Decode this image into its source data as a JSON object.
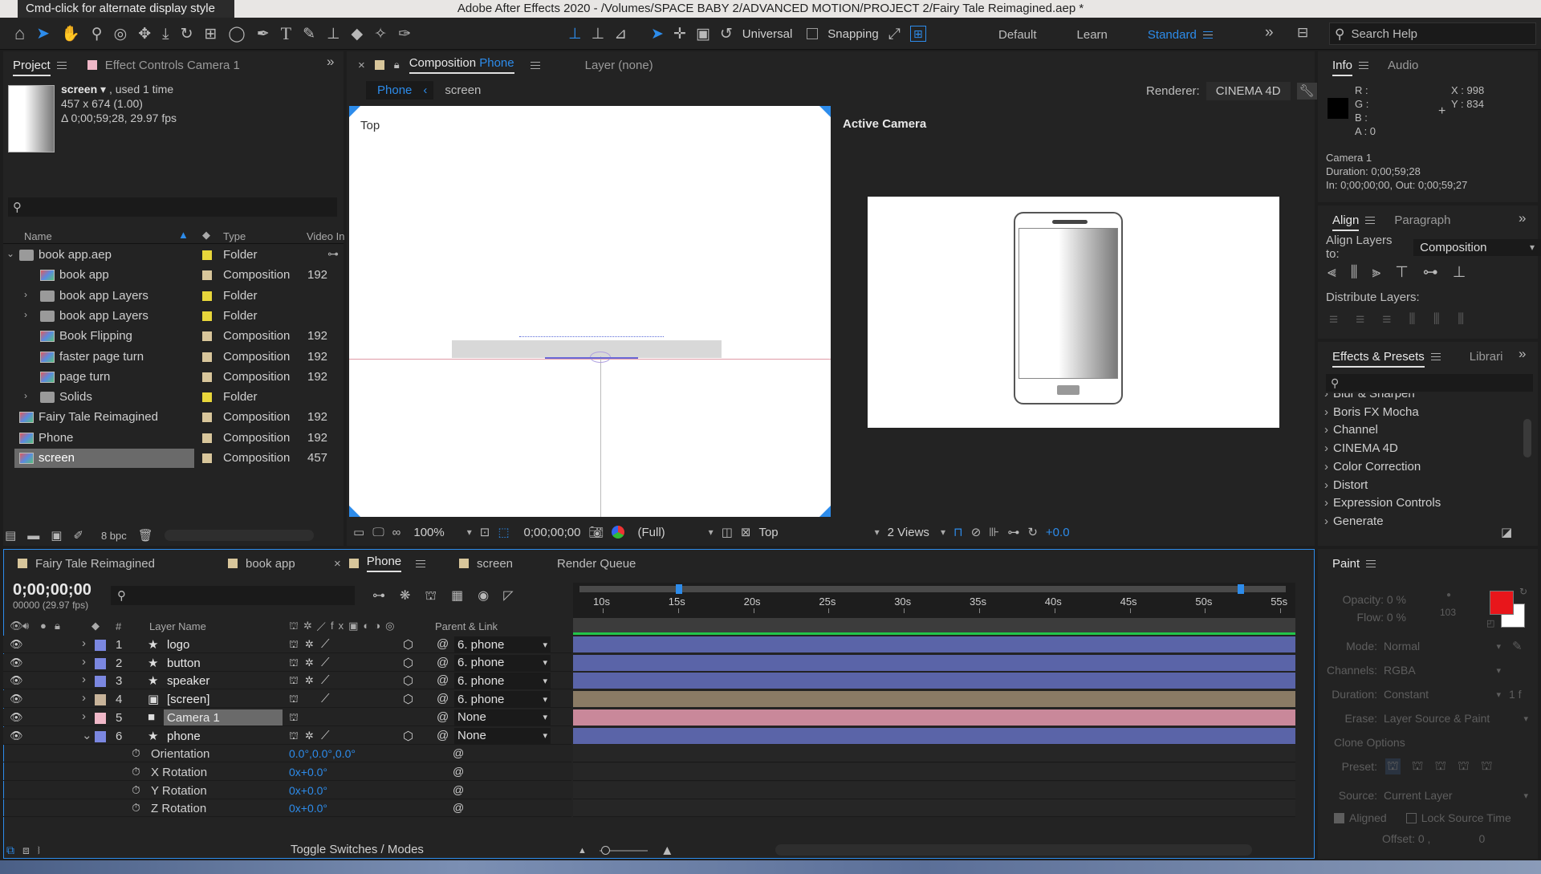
{
  "system": {
    "tooltip": "Cmd-click for alternate display style",
    "window_title": "Adobe After Effects 2020 - /Volumes/SPACE BABY 2/ADVANCED MOTION/PROJECT 2/Fairy Tale Reimagined.aep *"
  },
  "toolbar": {
    "axis_mode": "Universal",
    "snapping": "Snapping",
    "workspaces": [
      "Default",
      "Learn",
      "Standard"
    ],
    "search_placeholder": "Search Help"
  },
  "project_panel": {
    "tabs": [
      "Project",
      "Effect Controls Camera 1"
    ],
    "item_name": "screen",
    "item_used": ", used 1 time",
    "item_dims": "457 x 674 (1.00)",
    "item_duration": "Δ 0;00;59;28, 29.97 fps",
    "columns": [
      "Name",
      "Type",
      "Video In"
    ],
    "items": [
      {
        "name": "book app.aep",
        "type": "Folder",
        "vid": "",
        "color": "#e8d63b",
        "kind": "folder",
        "indent": 0,
        "twirl": "open"
      },
      {
        "name": "book app",
        "type": "Composition",
        "vid": "192",
        "color": "#d8c69b",
        "kind": "comp",
        "indent": 1,
        "twirl": ""
      },
      {
        "name": "book app Layers",
        "type": "Folder",
        "vid": "",
        "color": "#e8d63b",
        "kind": "folder",
        "indent": 1,
        "twirl": "closed"
      },
      {
        "name": "book app Layers",
        "type": "Folder",
        "vid": "",
        "color": "#e8d63b",
        "kind": "folder",
        "indent": 1,
        "twirl": "closed"
      },
      {
        "name": "Book Flipping",
        "type": "Composition",
        "vid": "192",
        "color": "#d8c69b",
        "kind": "comp",
        "indent": 1,
        "twirl": ""
      },
      {
        "name": "faster page turn",
        "type": "Composition",
        "vid": "192",
        "color": "#d8c69b",
        "kind": "comp",
        "indent": 1,
        "twirl": ""
      },
      {
        "name": "page turn",
        "type": "Composition",
        "vid": "192",
        "color": "#d8c69b",
        "kind": "comp",
        "indent": 1,
        "twirl": ""
      },
      {
        "name": "Solids",
        "type": "Folder",
        "vid": "",
        "color": "#e8d63b",
        "kind": "folder",
        "indent": 1,
        "twirl": "closed"
      },
      {
        "name": "Fairy Tale Reimagined",
        "type": "Composition",
        "vid": "192",
        "color": "#d8c69b",
        "kind": "comp",
        "indent": 0,
        "twirl": ""
      },
      {
        "name": "Phone",
        "type": "Composition",
        "vid": "192",
        "color": "#d8c69b",
        "kind": "comp",
        "indent": 0,
        "twirl": ""
      },
      {
        "name": "screen",
        "type": "Composition",
        "vid": "457",
        "color": "#d8c69b",
        "kind": "comp",
        "indent": 0,
        "twirl": "",
        "selected": true
      }
    ],
    "bpc": "8 bpc"
  },
  "composition_panel": {
    "tab_prefix": "Composition",
    "tab_name": "Phone",
    "layer_tab": "Layer (none)",
    "breadcrumbs": [
      "Phone",
      "screen"
    ],
    "renderer_label": "Renderer:",
    "renderer_value": "CINEMA 4D",
    "left_view_label": "Top",
    "right_view_label": "Active Camera",
    "zoom": "100%",
    "timecode": "0;00;00;00",
    "resolution": "(Full)",
    "view": "Top",
    "views_count": "2 Views",
    "exposure": "+0.0"
  },
  "info_panel": {
    "tabs": [
      "Info",
      "Audio"
    ],
    "rgba_labels": [
      "R :",
      "G :",
      "B :",
      "A :  0"
    ],
    "x": "X : 998",
    "y": "Y : 834",
    "layer_name": "Camera 1",
    "duration": "Duration: 0;00;59;28",
    "in_out": "In: 0;00;00;00, Out: 0;00;59;27"
  },
  "align_panel": {
    "tabs": [
      "Align",
      "Paragraph"
    ],
    "align_to_label": "Align Layers to:",
    "align_to_value": "Composition",
    "distribute_label": "Distribute Layers:"
  },
  "effects_panel": {
    "tabs": [
      "Effects & Presets",
      "Librari"
    ],
    "items": [
      "Blur & Sharpen",
      "Boris FX Mocha",
      "Channel",
      "CINEMA 4D",
      "Color Correction",
      "Distort",
      "Expression Controls",
      "Generate"
    ]
  },
  "timeline": {
    "tabs": [
      {
        "label": "Fairy Tale Reimagined",
        "color": "#d8c69b"
      },
      {
        "label": "book app",
        "color": "#d8c69b"
      },
      {
        "label": "Phone",
        "color": "#d8c69b",
        "active": true
      },
      {
        "label": "screen",
        "color": "#d8c69b"
      },
      {
        "label": "Render Queue",
        "color": ""
      }
    ],
    "timecode": "0;00;00;00",
    "timecode_sub": "00000 (29.97 fps)",
    "col_layer_name": "Layer Name",
    "col_parent": "Parent & Link",
    "col_hash": "#",
    "ruler_labels": [
      "10s",
      "15s",
      "20s",
      "25s",
      "30s",
      "35s",
      "40s",
      "45s",
      "50s",
      "55s"
    ],
    "layers": [
      {
        "num": "1",
        "name": "logo",
        "parent": "6. phone",
        "color": "#7b87e0",
        "kind": "star",
        "bar": "#5a64a8"
      },
      {
        "num": "2",
        "name": "button",
        "parent": "6. phone",
        "color": "#7b87e0",
        "kind": "star",
        "bar": "#5a64a8"
      },
      {
        "num": "3",
        "name": "speaker",
        "parent": "6. phone",
        "color": "#7b87e0",
        "kind": "star",
        "bar": "#5a64a8"
      },
      {
        "num": "4",
        "name": "[screen]",
        "parent": "6. phone",
        "color": "#c8b49a",
        "kind": "comp",
        "bar": "#8a7b65"
      },
      {
        "num": "5",
        "name": "Camera 1",
        "parent": "None",
        "color": "#f0b8c8",
        "kind": "camera",
        "bar": "#c9889a",
        "selected": true
      },
      {
        "num": "6",
        "name": "phone",
        "parent": "None",
        "color": "#7b87e0",
        "kind": "star",
        "bar": "#5a64a8",
        "open": true
      }
    ],
    "properties": [
      {
        "name": "Orientation",
        "value": "0.0°,0.0°,0.0°"
      },
      {
        "name": "X Rotation",
        "value": "0x+0.0°"
      },
      {
        "name": "Y Rotation",
        "value": "0x+0.0°"
      },
      {
        "name": "Z Rotation",
        "value": "0x+0.0°"
      }
    ],
    "toggle_label": "Toggle Switches / Modes"
  },
  "paint_panel": {
    "title": "Paint",
    "opacity": "Opacity: 0 %",
    "flow": "Flow: 0 %",
    "brush_size": "103",
    "mode_label": "Mode:",
    "mode_value": "Normal",
    "channels_label": "Channels:",
    "channels_value": "RGBA",
    "duration_label": "Duration:",
    "duration_value": "Constant",
    "duration_frames": "1  f",
    "erase_label": "Erase:",
    "erase_value": "Layer Source & Paint",
    "clone_options": "Clone Options",
    "preset_label": "Preset:",
    "source_label": "Source:",
    "source_value": "Current Layer",
    "aligned": "Aligned",
    "lock_source": "Lock Source Time",
    "offset": "Offset: 0 ,",
    "offset_y": "0",
    "fg_color": "#e8161b",
    "bg_color": "#ffffff"
  }
}
